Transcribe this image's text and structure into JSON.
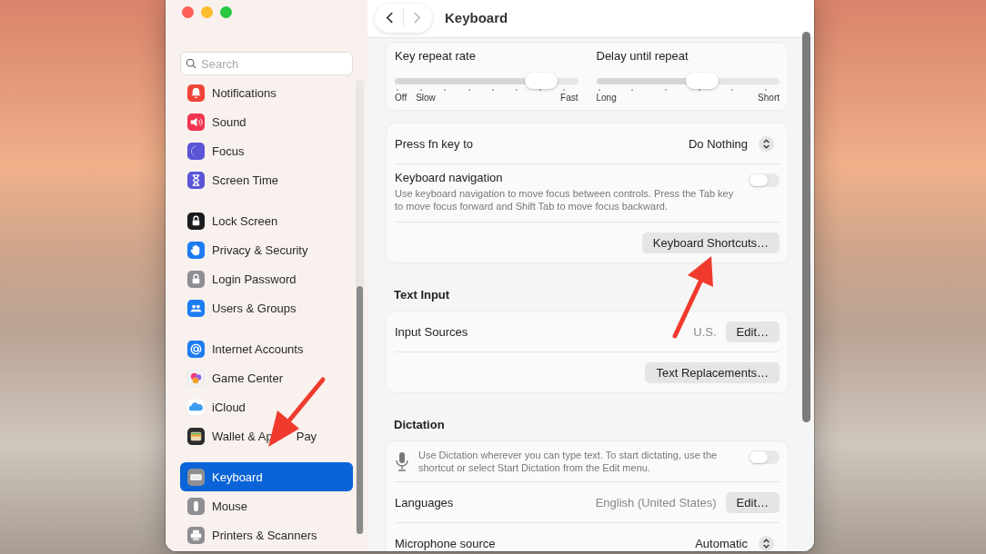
{
  "window": {
    "title": "Keyboard"
  },
  "sidebar": {
    "search": {
      "placeholder": "Search"
    },
    "groups": [
      [
        {
          "label": "Notifications",
          "color": "#f0453a",
          "selected": false
        },
        {
          "label": "Sound",
          "color": "#f0344f",
          "selected": false
        },
        {
          "label": "Focus",
          "color": "#5b55d6",
          "selected": false
        },
        {
          "label": "Screen Time",
          "color": "#5b55d6",
          "selected": false
        }
      ],
      [
        {
          "label": "Lock Screen",
          "color": "#1c1c1e",
          "selected": false
        },
        {
          "label": "Privacy & Security",
          "color": "#1e7cf2",
          "selected": false
        },
        {
          "label": "Login Password",
          "color": "#8e8e93",
          "selected": false
        },
        {
          "label": "Users & Groups",
          "color": "#1e7cf2",
          "selected": false
        }
      ],
      [
        {
          "label": "Internet Accounts",
          "color": "#1e7cf2",
          "selected": false
        },
        {
          "label": "Game Center",
          "color": "#f2f2f4",
          "selected": false
        },
        {
          "label": "iCloud",
          "color": "#ffffff",
          "selected": false
        },
        {
          "label": "Wallet & Ap",
          "label_end": "Pay",
          "color": "#2b2b2d",
          "selected": false
        }
      ],
      [
        {
          "label": "Keyboard",
          "color": "#8e8e93",
          "selected": true
        },
        {
          "label": "Mouse",
          "color": "#8e8e93",
          "selected": false
        },
        {
          "label": "Printers & Scanners",
          "color": "#8e8e93",
          "selected": false
        }
      ]
    ]
  },
  "sliders": [
    {
      "label": "Key repeat rate",
      "level": 0.8,
      "scale_labels": [
        "Off",
        "Slow",
        "Fast"
      ]
    },
    {
      "label": "Delay until repeat",
      "level": 0.58,
      "scale_labels": [
        "Long",
        "Short"
      ]
    }
  ],
  "sections": [
    {
      "rows": [
        {
          "kind": "popup",
          "label": "Press fn key to",
          "value": "Do Nothing"
        },
        {
          "kind": "toggle",
          "label": "Keyboard navigation",
          "description": "Use keyboard navigation to move focus between controls. Press the Tab key to move focus forward and Shift Tab to move focus backward.",
          "on": false
        },
        {
          "kind": "button",
          "button": "Keyboard Shortcuts…"
        }
      ]
    },
    {
      "heading": "Text Input",
      "rows": [
        {
          "kind": "value_button",
          "label": "Input Sources",
          "value": "U.S.",
          "button": "Edit…"
        },
        {
          "kind": "button",
          "button": "Text Replacements…"
        }
      ]
    },
    {
      "heading": "Dictation",
      "rows": [
        {
          "kind": "mic_toggle",
          "description": "Use Dictation wherever you can type text. To start dictating, use the shortcut or select Start Dictation from the Edit menu.",
          "on": false
        },
        {
          "kind": "value_button",
          "label": "Languages",
          "value": "English (United States)",
          "button": "Edit…"
        },
        {
          "kind": "popup",
          "label": "Microphone source",
          "value": "Automatic"
        }
      ]
    }
  ]
}
